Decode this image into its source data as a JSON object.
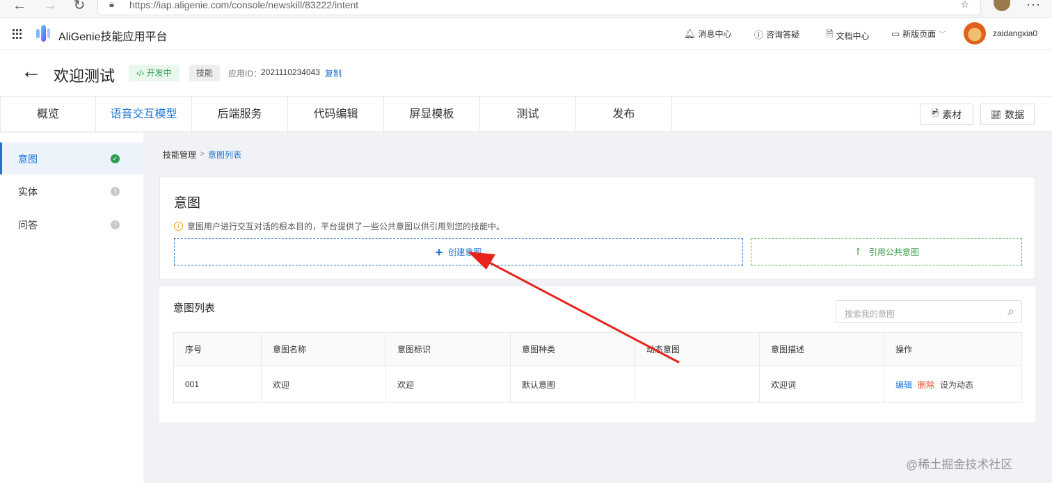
{
  "browser": {
    "url": "https://iap.aligenie.com/console/newskill/83222/intent"
  },
  "header": {
    "brand": "AliGenie技能应用平台",
    "links": [
      {
        "label": "消息中心",
        "icon": "bell-icon"
      },
      {
        "label": "咨询答疑",
        "icon": "question-icon"
      },
      {
        "label": "文档中心",
        "icon": "document-icon"
      },
      {
        "label": "新版页面",
        "icon": "window-icon"
      }
    ],
    "username": "zaidangxia0"
  },
  "titlebar": {
    "title": "欢迎测试",
    "status_tag": "开发中",
    "type_tag": "技能",
    "app_id_label": "应用ID：",
    "app_id": "2021110234043",
    "copy_label": "复制"
  },
  "tabs": [
    "概览",
    "语音交互模型",
    "后端服务",
    "代码编辑",
    "屏显模板",
    "测试",
    "发布"
  ],
  "active_tab": "语音交互模型",
  "toolbar": {
    "assets_label": "素材",
    "data_label": "数据"
  },
  "sidebar": {
    "items": [
      {
        "label": "意图",
        "status": "done"
      },
      {
        "label": "实体",
        "status": "pending"
      },
      {
        "label": "问答",
        "status": "pending"
      }
    ]
  },
  "breadcrumb": {
    "parent": "技能管理",
    "separator": ">",
    "current": "意图列表"
  },
  "intent_card": {
    "title": "意图",
    "tip": "意图用户进行交互对话的根本目的，平台提供了一些公共意图以供引用到您的技能中。",
    "create_label": "创建意图",
    "reference_label": "引用公共意图"
  },
  "list_card": {
    "title": "意图列表",
    "search_placeholder": "搜索我的意图",
    "columns": [
      "序号",
      "意图名称",
      "意图标识",
      "意图种类",
      "动态意图",
      "意图描述",
      "操作"
    ],
    "rows": [
      {
        "no": "001",
        "name": "欢迎",
        "id": "欢迎",
        "kind": "默认意图",
        "dynamic": "",
        "desc": "欢迎词"
      }
    ],
    "actions": {
      "edit": "编辑",
      "delete": "删除",
      "set_dynamic": "设为动态"
    }
  },
  "watermark": "@稀土掘金技术社区",
  "colors": {
    "accent": "#1f76d2",
    "success": "#2a9d52",
    "danger": "#e8502a",
    "annotation_arrow": "#e8231c"
  }
}
